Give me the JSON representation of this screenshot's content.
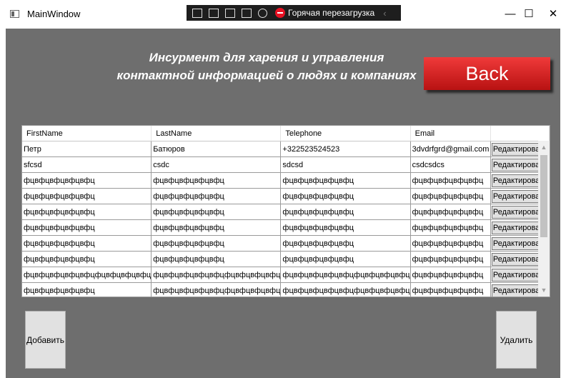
{
  "window": {
    "title": "MainWindow",
    "minimize_glyph": "—",
    "maximize_glyph": "☐",
    "close_glyph": "✕"
  },
  "debug_toolbar": {
    "hot_reload_label": "Горячая перезагрузка",
    "collapse_glyph": "‹",
    "icons": [
      "select-element-icon",
      "pointer-icon",
      "layout-adorner-icon",
      "track-focus-icon",
      "binding-icon",
      "stop-icon"
    ]
  },
  "header": {
    "line1": "Инсурмент для харения и управления",
    "line2": "контактной информацией о людях и компаниях"
  },
  "back_button": {
    "label": "Back",
    "color": "#e02424"
  },
  "grid": {
    "columns": [
      "FirstName",
      "LastName",
      "Telephone",
      "Email",
      ""
    ],
    "edit_label": "Редактировать",
    "rows": [
      [
        "Петр",
        "Батюров",
        "+322523524523",
        "3dvdrfgrd@gmail.com"
      ],
      [
        "sfcsd",
        "csdc",
        "sdcsd",
        "csdcsdcs"
      ],
      [
        "фцвфцвфцвфцвфц",
        "фцвфцвфцвфцвфц",
        "фцвфцвфцвфцвфц",
        "фцвфцвфцвфцвфц"
      ],
      [
        "фцвфцвфцвфцвфц",
        "фцвфцвфцвфцвфц",
        "фцвфцвфцвфцвфц",
        "фцвфцвфцвфцвфц"
      ],
      [
        "фцвфцвфцвфцвфц",
        "фцвфцвфцвфцвфц",
        "фцвфцвфцвфцвфц",
        "фцвфцвфцвфцвфц"
      ],
      [
        "фцвфцвфцвфцвфц",
        "фцвфцвфцвфцвфц",
        "фцвфцвфцвфцвфц",
        "фцвфцвфцвфцвфц"
      ],
      [
        "фцвфцвфцвфцвфц",
        "фцвфцвфцвфцвфц",
        "фцвфцвфцвфцвфц",
        "фцвфцвфцвфцвфц"
      ],
      [
        "фцвфцвфцвфцвфц",
        "фцвфцвфцвфцвфц",
        "фцвфцвфцвфцвфц",
        "фцвфцвфцвфцвфц"
      ],
      [
        "фцвфцвфцвфцвфцфцвфцвфцвфц",
        "фцвфцвфцвфцвфцфцвфцвфцвфц",
        "фцвфцвфцвфцвфцфцвфцвфцвфц",
        "фцвфцвфцвфцвфц"
      ],
      [
        "фцвфцвфцвфцвфц",
        "фцвфцвфцвфцвфцфцвфцвфцвфц",
        "фцвфцвфцвфцвфцфцвфцвфцвфц",
        "фцвфцвфцвфцвфц"
      ]
    ]
  },
  "add_button": {
    "label": "Добавить"
  },
  "delete_button": {
    "label": "Удалить"
  },
  "colors": {
    "background": "#6e6e6e",
    "heading": "#ffffff"
  }
}
